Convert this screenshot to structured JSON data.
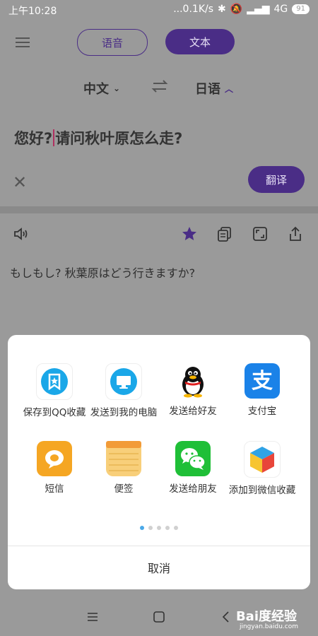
{
  "status_bar": {
    "time": "上午10:28",
    "network_speed": "...0.1K/s",
    "network_type": "4G",
    "battery": "91",
    "icons": [
      "bluetooth-icon",
      "mute-icon",
      "signal-icon",
      "battery-icon"
    ]
  },
  "header": {
    "menu_icon": "menu-icon",
    "voice_tab": "语音",
    "text_tab": "文本"
  },
  "languages": {
    "source": "中文",
    "target": "日语"
  },
  "input": {
    "text_before_cursor": "您好?",
    "text_after_cursor": "请问秋叶原怎么走?",
    "translate_label": "翻译"
  },
  "result": {
    "text": "もしもし? 秋葉原はどう行きますか?"
  },
  "share_sheet": {
    "items": [
      {
        "label": "保存到QQ收藏"
      },
      {
        "label": "发送到我的电脑"
      },
      {
        "label": "发送给好友"
      },
      {
        "label": "支付宝"
      },
      {
        "label": "短信"
      },
      {
        "label": "便签"
      },
      {
        "label": "发送给朋友"
      },
      {
        "label": "添加到微信收藏"
      }
    ],
    "page_count": 5,
    "current_page": 1,
    "cancel_label": "取消"
  },
  "watermark": {
    "brand": "Bai度经验",
    "url": "jingyan.baidu.com"
  },
  "colors": {
    "accent": "#4a2d86",
    "overlay": "#9a9a9a",
    "alipay_blue": "#1a82e8",
    "wechat_green": "#1fbf37"
  }
}
